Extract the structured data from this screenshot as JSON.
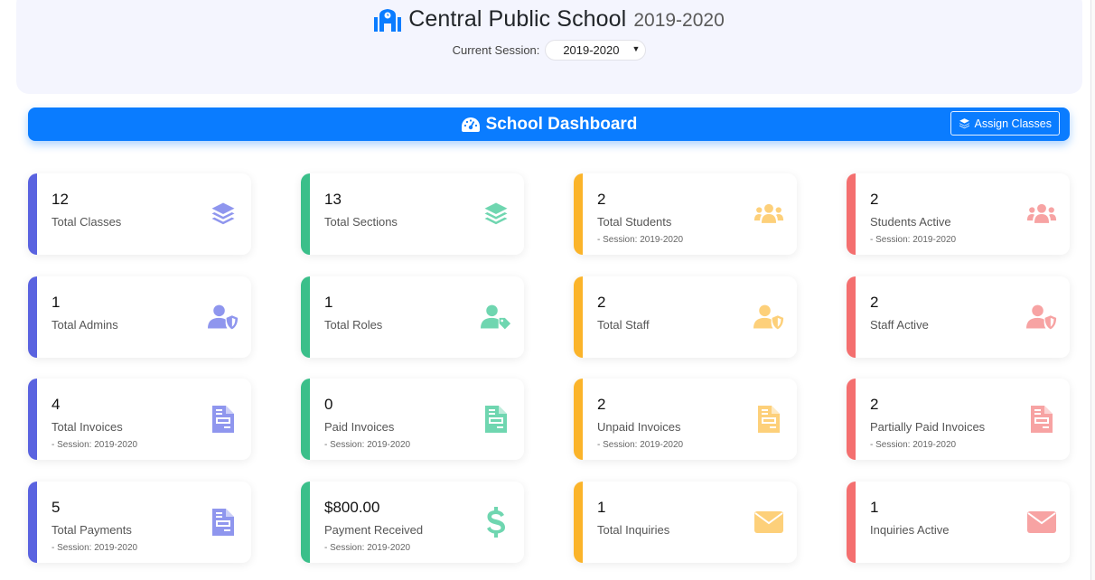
{
  "header": {
    "school_name": "Central Public School",
    "school_year": "2019-2020",
    "session_label": "Current Session:",
    "session_value": "2019-2020"
  },
  "dashboard": {
    "title": "School Dashboard",
    "assign_button": "Assign Classes",
    "accent": "#0a7cff"
  },
  "colors": {
    "indigo": "#5a63e0",
    "green": "#3bbf8a",
    "yellow": "#fbb42a",
    "red": "#f46f6f",
    "indigo_icon": "#8f96ee",
    "green_icon": "#6fd6b0",
    "yellow_icon": "#fdd07a",
    "red_icon": "#f7a3a3"
  },
  "cards": [
    {
      "value": "12",
      "label": "Total Classes",
      "sub": "",
      "icon": "layers-icon",
      "color": "indigo"
    },
    {
      "value": "13",
      "label": "Total Sections",
      "sub": "",
      "icon": "layers-icon",
      "color": "green"
    },
    {
      "value": "2",
      "label": "Total Students",
      "sub": "- Session: 2019-2020",
      "icon": "users-icon",
      "color": "yellow"
    },
    {
      "value": "2",
      "label": "Students Active",
      "sub": "- Session: 2019-2020",
      "icon": "users-icon",
      "color": "red"
    },
    {
      "value": "1",
      "label": "Total Admins",
      "sub": "",
      "icon": "user-shield-icon",
      "color": "indigo"
    },
    {
      "value": "1",
      "label": "Total Roles",
      "sub": "",
      "icon": "user-tag-icon",
      "color": "green"
    },
    {
      "value": "2",
      "label": "Total Staff",
      "sub": "",
      "icon": "user-shield-icon",
      "color": "yellow"
    },
    {
      "value": "2",
      "label": "Staff Active",
      "sub": "",
      "icon": "user-shield-icon",
      "color": "red"
    },
    {
      "value": "4",
      "label": "Total Invoices",
      "sub": "- Session: 2019-2020",
      "icon": "invoice-icon",
      "color": "indigo"
    },
    {
      "value": "0",
      "label": "Paid Invoices",
      "sub": "- Session: 2019-2020",
      "icon": "invoice-icon",
      "color": "green"
    },
    {
      "value": "2",
      "label": "Unpaid Invoices",
      "sub": "- Session: 2019-2020",
      "icon": "invoice-icon",
      "color": "yellow"
    },
    {
      "value": "2",
      "label": "Partially Paid Invoices",
      "sub": "- Session: 2019-2020",
      "icon": "invoice-icon",
      "color": "red"
    },
    {
      "value": "5",
      "label": "Total Payments",
      "sub": "- Session: 2019-2020",
      "icon": "invoice-icon",
      "color": "indigo"
    },
    {
      "value": "$800.00",
      "label": "Payment Received",
      "sub": "- Session: 2019-2020",
      "icon": "dollar-icon",
      "color": "green"
    },
    {
      "value": "1",
      "label": "Total Inquiries",
      "sub": "",
      "icon": "envelope-icon",
      "color": "yellow"
    },
    {
      "value": "1",
      "label": "Inquiries Active",
      "sub": "",
      "icon": "envelope-icon",
      "color": "red"
    }
  ]
}
